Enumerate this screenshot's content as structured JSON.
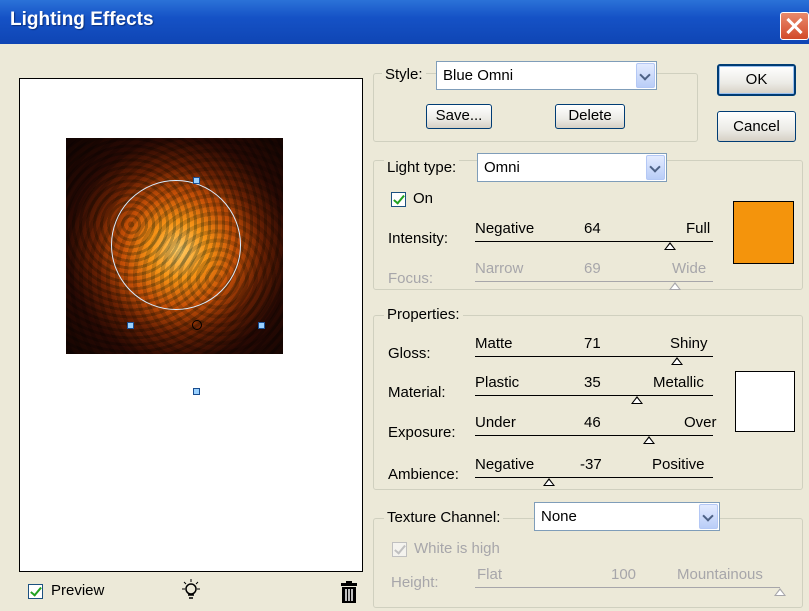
{
  "window": {
    "title": "Lighting Effects"
  },
  "style": {
    "label": "Style:",
    "value": "Blue Omni",
    "save": "Save...",
    "delete": "Delete"
  },
  "buttons": {
    "ok": "OK",
    "cancel": "Cancel"
  },
  "light": {
    "type_label": "Light type:",
    "type_value": "Omni",
    "on_label": "On",
    "on_checked": true,
    "color": "#f4940c"
  },
  "intensity": {
    "label": "Intensity:",
    "min": "Negative",
    "value": "64",
    "max": "Full",
    "level": 0.82
  },
  "focus": {
    "label": "Focus:",
    "min": "Narrow",
    "value": "69",
    "max": "Wide",
    "level": 0.84
  },
  "properties": {
    "title": "Properties:",
    "color": "#ffffff"
  },
  "gloss": {
    "label": "Gloss:",
    "min": "Matte",
    "value": "71",
    "max": "Shiny",
    "level": 0.85
  },
  "material": {
    "label": "Material:",
    "min": "Plastic",
    "value": "35",
    "max": "Metallic",
    "level": 0.68
  },
  "exposure": {
    "label": "Exposure:",
    "min": "Under",
    "value": "46",
    "max": "Over",
    "level": 0.73
  },
  "ambience": {
    "label": "Ambience:",
    "min": "Negative",
    "value": "-37",
    "max": "Positive",
    "level": 0.31
  },
  "texture": {
    "label": "Texture Channel:",
    "value": "None",
    "white_label": "White is high",
    "white_checked": true
  },
  "height": {
    "label": "Height:",
    "min": "Flat",
    "value": "100",
    "max": "Mountainous",
    "level": 1.0
  },
  "preview": {
    "label": "Preview",
    "checked": true
  }
}
